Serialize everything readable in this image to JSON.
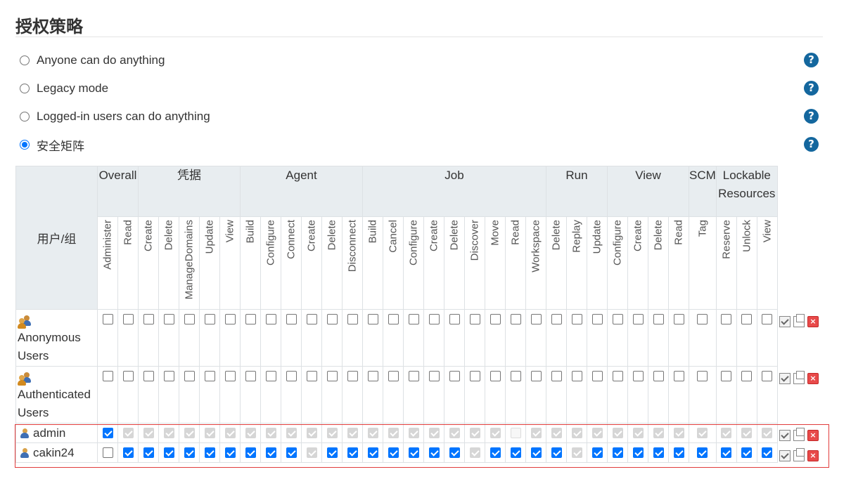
{
  "section": {
    "title": "授权策略"
  },
  "strategies": [
    {
      "label": "Anyone can do anything",
      "selected": false
    },
    {
      "label": "Legacy mode",
      "selected": false
    },
    {
      "label": "Logged-in users can do anything",
      "selected": false
    },
    {
      "label": "安全矩阵",
      "selected": true
    }
  ],
  "help_icon": "?",
  "matrix": {
    "corner_label": "用户/组",
    "groups": [
      {
        "label": "Overall",
        "span": 2
      },
      {
        "label": "凭据",
        "span": 5
      },
      {
        "label": "Agent",
        "span": 6
      },
      {
        "label": "Job",
        "span": 9
      },
      {
        "label": "Run",
        "span": 3
      },
      {
        "label": "View",
        "span": 4
      },
      {
        "label": "SCM",
        "span": 1
      },
      {
        "label": "Lockable Resources",
        "span": 3
      }
    ],
    "permissions": [
      "Administer",
      "Read",
      "Create",
      "Delete",
      "ManageDomains",
      "Update",
      "View",
      "Build",
      "Configure",
      "Connect",
      "Create",
      "Delete",
      "Disconnect",
      "Build",
      "Cancel",
      "Configure",
      "Create",
      "Delete",
      "Discover",
      "Move",
      "Read",
      "Workspace",
      "Delete",
      "Replay",
      "Update",
      "Configure",
      "Create",
      "Delete",
      "Read",
      "Tag",
      "Reserve",
      "Unlock",
      "View"
    ],
    "rows": [
      {
        "name": "Anonymous Users",
        "icon": "group-icon",
        "states": "uuuuuuuuuuuuuuuuuuuuuuuuuuuuuuuuu"
      },
      {
        "name": "Authenticated Users",
        "icon": "group-icon",
        "states": "uuuuuuuuuuuuuuuuuuuuuuuuuuuuuuuuu"
      },
      {
        "name": "admin",
        "icon": "user-icon",
        "states": "cdddddddddddddddddddxddddddddddddd"
      },
      {
        "name": "cakin24",
        "icon": "user-icon",
        "states": "ucccccccccdcccccccdccccdccccccccc"
      }
    ]
  },
  "row_actions": {
    "toggle": "toggle-all-icon",
    "copy": "copy-icon",
    "delete": "delete-icon",
    "delete_glyph": "×"
  },
  "colors": {
    "accent": "#0075ff",
    "help": "#14679e",
    "highlight": "#e13c3c",
    "header_bg": "#e8edf0"
  }
}
